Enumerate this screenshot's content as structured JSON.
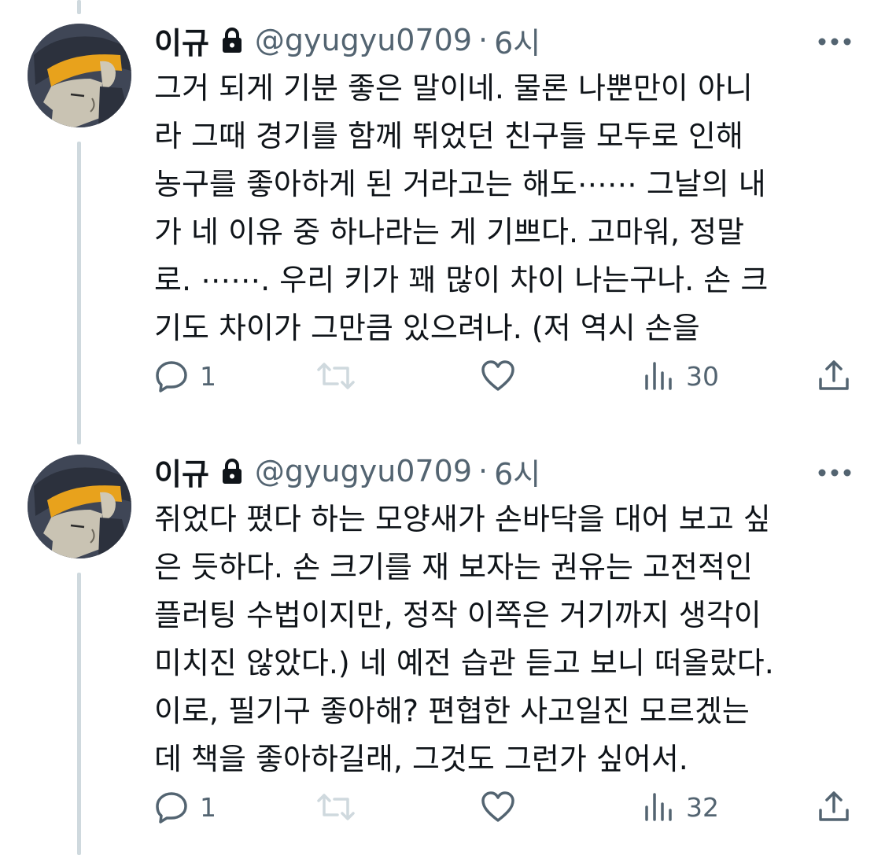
{
  "tweets": [
    {
      "name": "이규",
      "handle": "@gyugyu0709",
      "separator": "·",
      "time": "6시",
      "lines": [
        "그거 되게 기분 좋은 말이네. 물론 나뿐만이 아니",
        "라 그때 경기를 함께 뛰었던 친구들 모두로 인해",
        "농구를 좋아하게 된 거라고는 해도⋯⋯ 그날의 내",
        "가 네 이유 중 하나라는 게 기쁘다. 고마워, 정말",
        "로. ⋯⋯. 우리 키가 꽤 많이 차이 나는구나. 손 크",
        "기도 차이가 그만큼 있으려나. (저 역시 손을"
      ],
      "replies": "1",
      "views": "30"
    },
    {
      "name": "이규",
      "handle": "@gyugyu0709",
      "separator": "·",
      "time": "6시",
      "lines": [
        "쥐었다 폈다 하는 모양새가 손바닥을 대어 보고 싶",
        "은 듯하다. 손 크기를 재 보자는 권유는 고전적인",
        "플러팅 수법이지만, 정작 이쪽은 거기까지 생각이",
        "미치진 않았다.) 네 예전 습관 듣고 보니 떠올랐다.",
        "이로, 필기구 좋아해? 편협한 사고일진 모르겠는",
        "데 책을 좋아하길래, 그것도 그런가 싶어서."
      ],
      "replies": "1",
      "views": "32"
    }
  ],
  "colors": {
    "text": "#0f1419",
    "secondary": "#536471",
    "thread_line": "#cfd9de",
    "headband": "#e8a21c"
  },
  "icons": {
    "lock": "lock-icon",
    "more": "more-icon",
    "reply": "reply-icon",
    "retweet": "retweet-icon",
    "like": "heart-icon",
    "views": "views-icon",
    "share": "share-icon"
  }
}
